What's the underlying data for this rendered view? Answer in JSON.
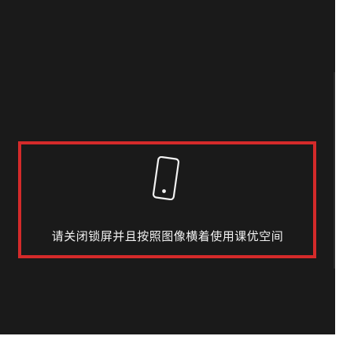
{
  "overlay": {
    "icon": "phone-rotate-icon",
    "message": "请关闭锁屏并且按照图像横着使用课优空间"
  },
  "colors": {
    "background": "#1a1a1a",
    "highlight_border": "#d42a2a",
    "text": "#f2f2f2"
  }
}
